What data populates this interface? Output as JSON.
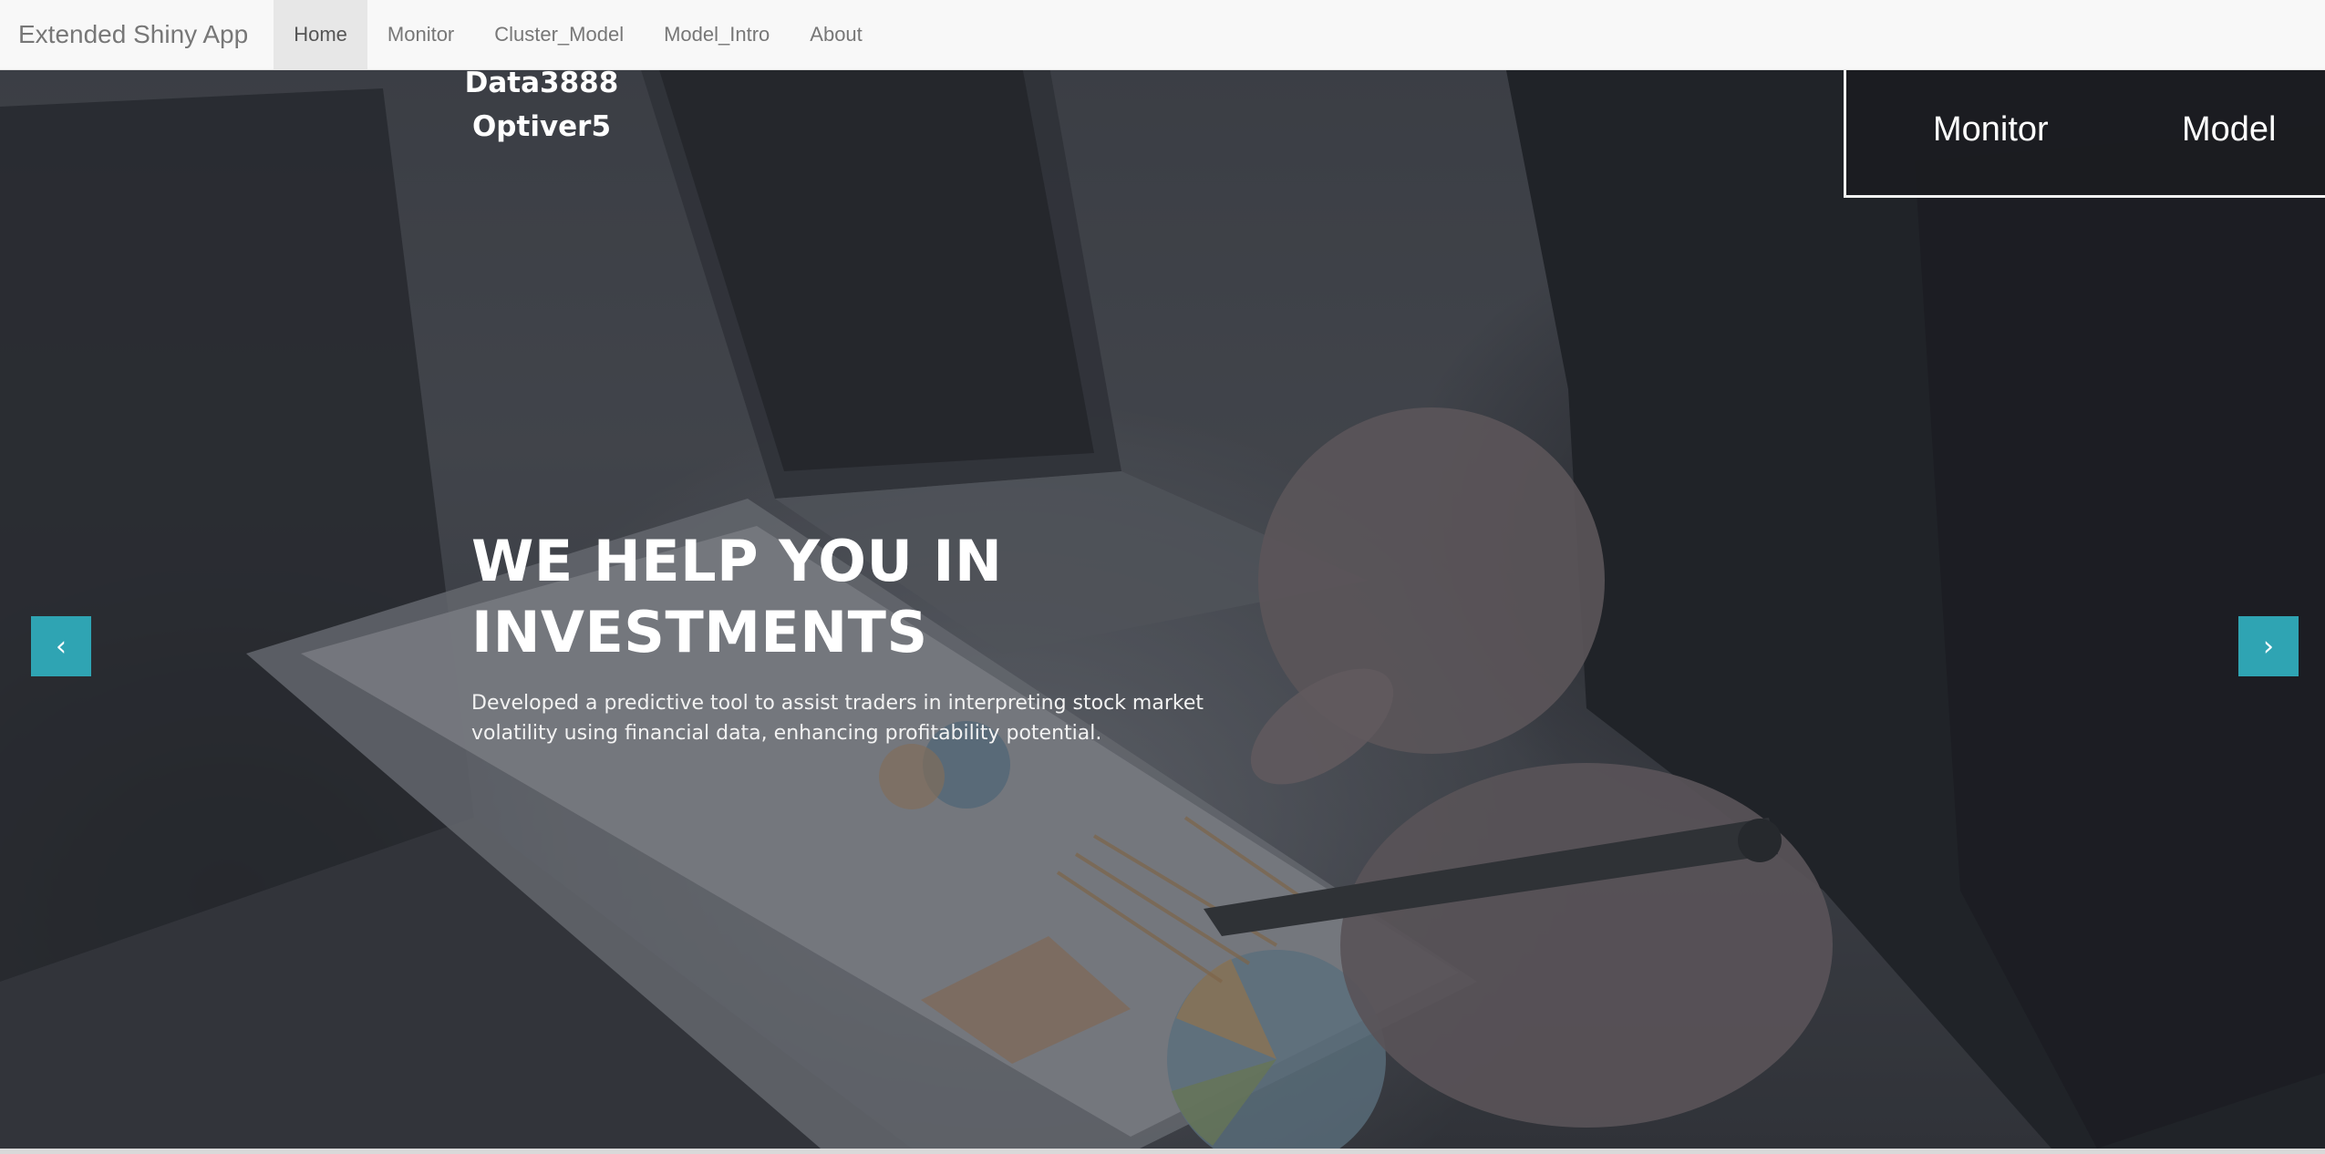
{
  "navbar": {
    "brand": "Extended Shiny App",
    "tabs": [
      {
        "label": "Home",
        "active": true
      },
      {
        "label": "Monitor",
        "active": false
      },
      {
        "label": "Cluster_Model",
        "active": false
      },
      {
        "label": "Model_Intro",
        "active": false
      },
      {
        "label": "About",
        "active": false
      }
    ]
  },
  "logo": {
    "line1": "Data3888",
    "line2": "Optiver5"
  },
  "cta": {
    "monitor_label": "Monitor",
    "model_label": "Model"
  },
  "hero": {
    "headline": "WE HELP YOU IN INVESTMENTS",
    "description": "Developed a predictive tool to assist traders in interpreting stock market volatility using financial data, enhancing profitability potential.",
    "prev_icon": "chevron-left-icon",
    "next_icon": "chevron-right-icon"
  },
  "colors": {
    "accent": "#2fa4b3",
    "navbar_bg": "#f8f8f8",
    "active_tab_bg": "#e7e7e7",
    "cta_bg": "#1b1c21"
  }
}
